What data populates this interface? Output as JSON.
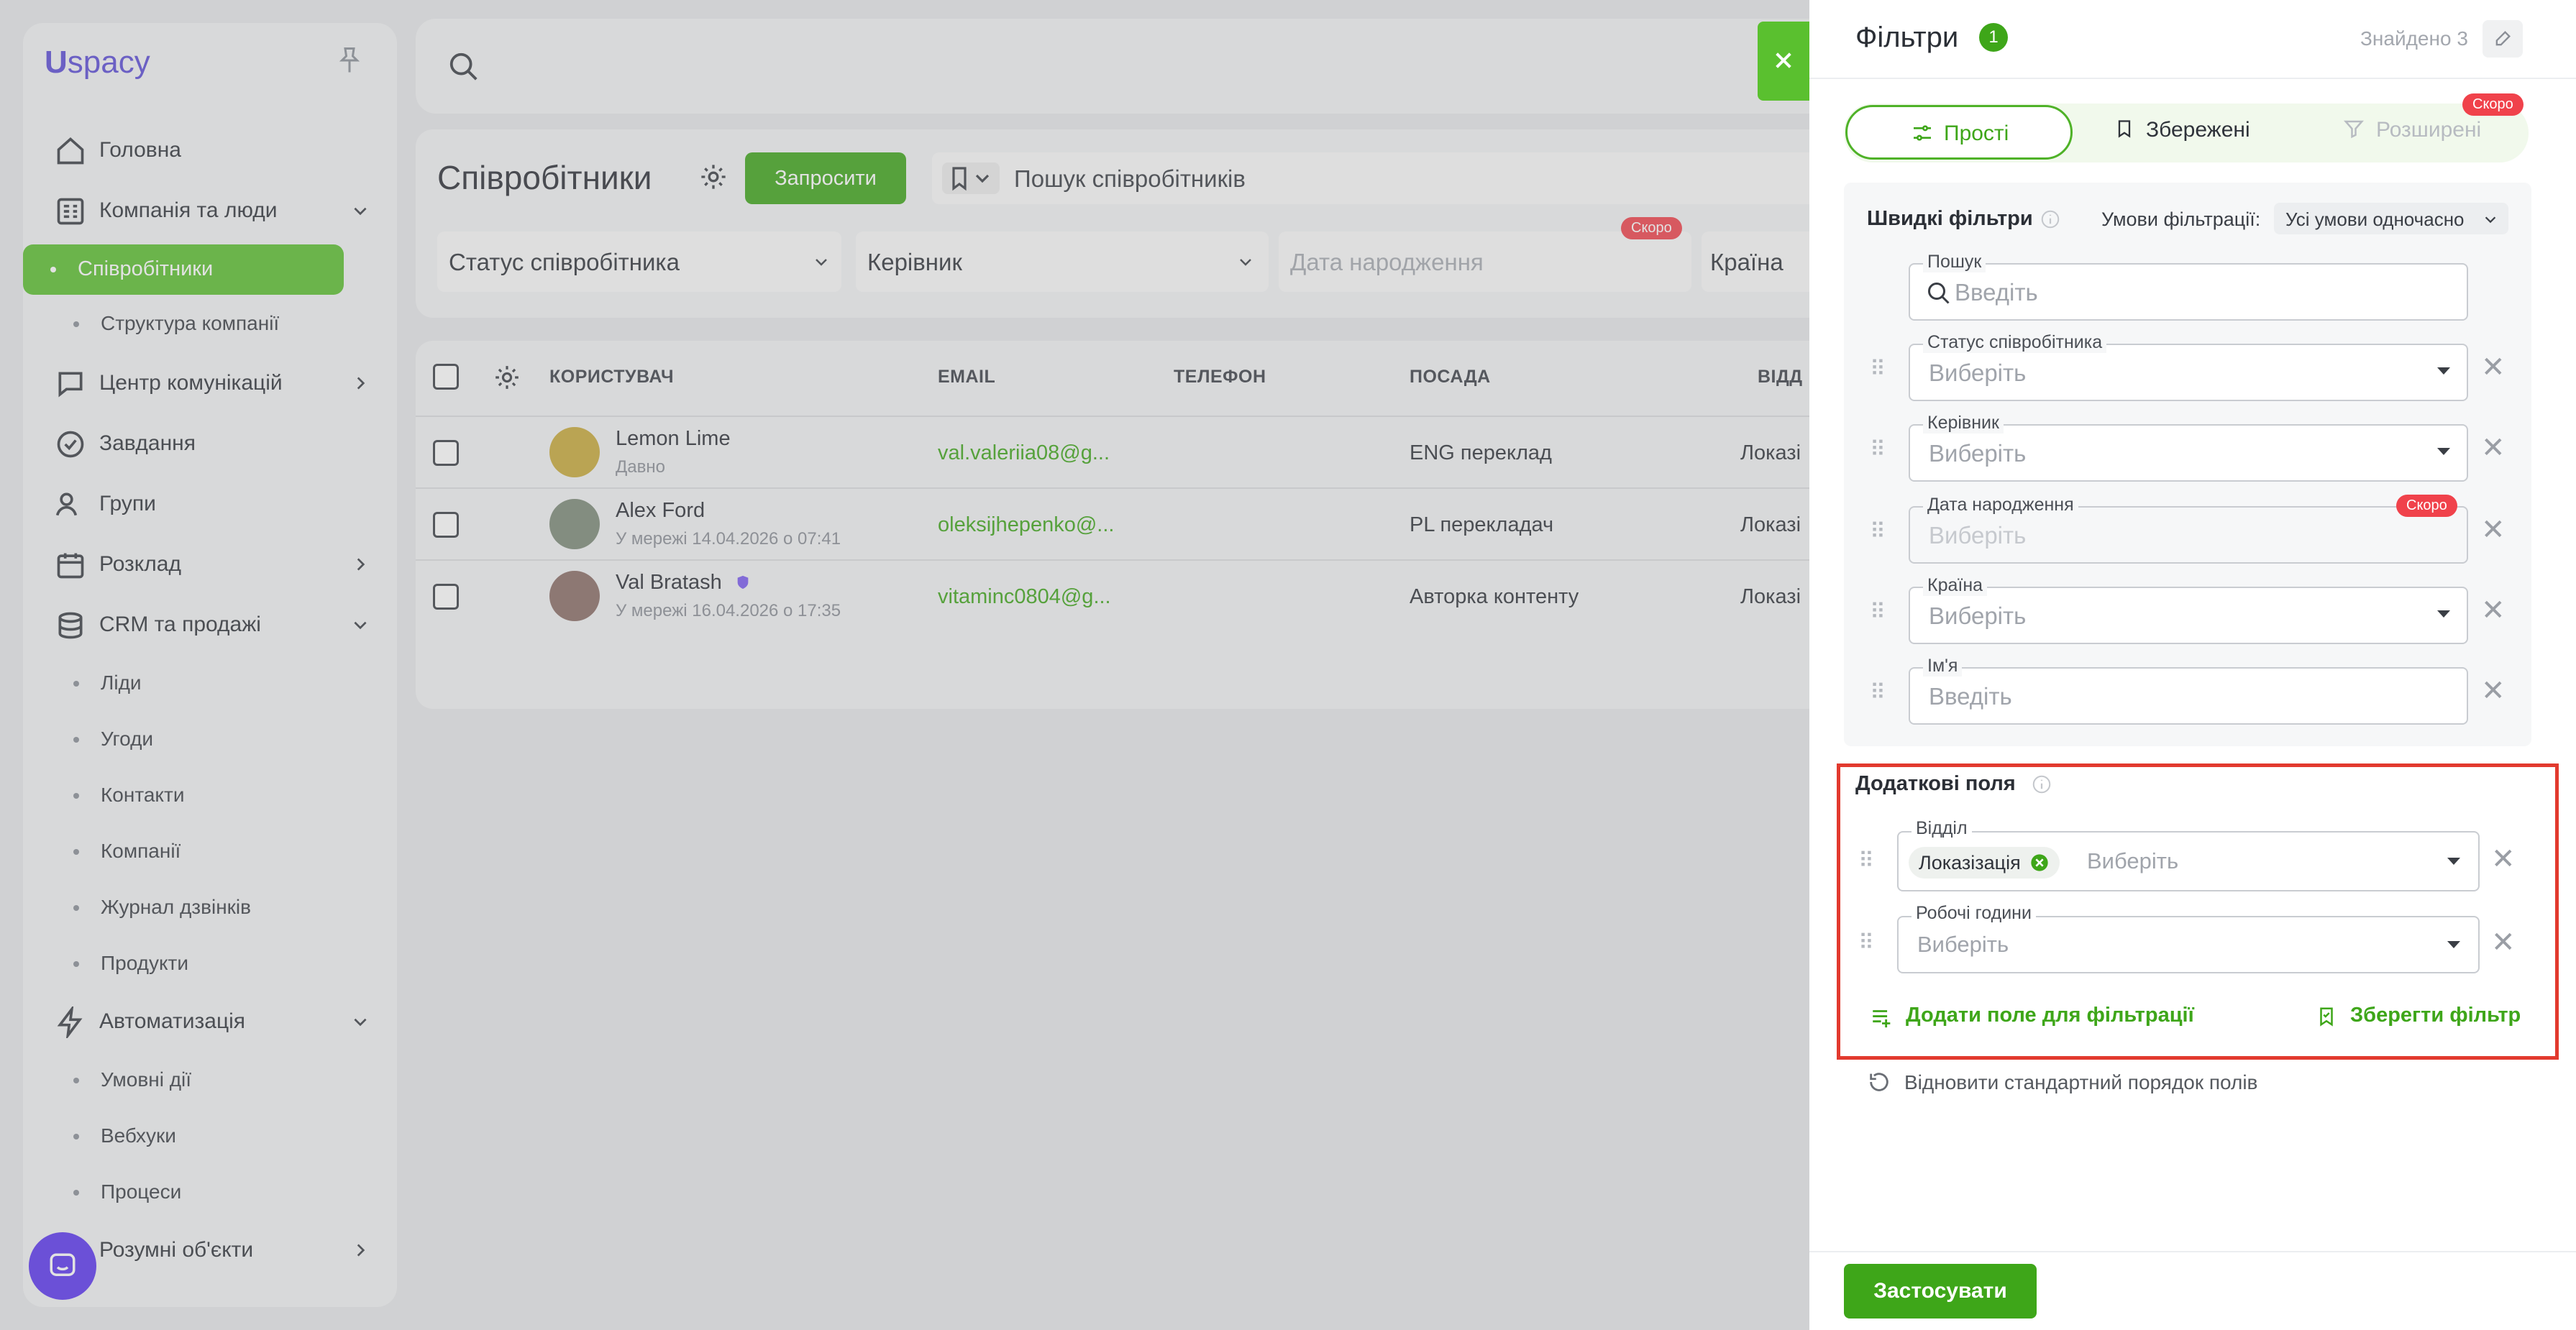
{
  "app": {
    "logo": "spacy",
    "logo_mark": "U"
  },
  "sidebar": {
    "items": [
      {
        "label": "Головна",
        "icon": "home-icon",
        "chevron": ""
      },
      {
        "label": "Компанія та люди",
        "icon": "company-icon",
        "chevron": "down"
      },
      {
        "label": "Центр комунікацій",
        "icon": "chat-icon",
        "chevron": "right"
      },
      {
        "label": "Завдання",
        "icon": "task-icon",
        "chevron": ""
      },
      {
        "label": "Групи",
        "icon": "groups-icon",
        "chevron": ""
      },
      {
        "label": "Розклад",
        "icon": "calendar-icon",
        "chevron": "right"
      },
      {
        "label": "CRM та продажі",
        "icon": "crm-icon",
        "chevron": "down"
      },
      {
        "label": "Автоматизація",
        "icon": "lightning-icon",
        "chevron": "down"
      },
      {
        "label": "Розумні об'єкти",
        "icon": "objects-icon",
        "chevron": "right"
      }
    ],
    "company_sub": [
      "Співробітники",
      "Структура компанії"
    ],
    "crm_sub": [
      "Ліди",
      "Угоди",
      "Контакти",
      "Компанії",
      "Журнал дзвінків",
      "Продукти"
    ],
    "auto_sub": [
      "Умовні дії",
      "Вебхуки",
      "Процеси"
    ]
  },
  "main": {
    "title": "Співробітники",
    "invite": "Запросити",
    "search_placeholder": "Пошук співробітників",
    "filters": [
      "Статус співробітника",
      "Керівник",
      "Дата народження",
      "Країна"
    ],
    "soon": "Скоро",
    "columns": [
      "КОРИСТУВАЧ",
      "EMAIL",
      "ТЕЛЕФОН",
      "ПОСАДА",
      "ВІДД"
    ],
    "rows": [
      {
        "name": "Lemon Lime",
        "sub": "Давно",
        "email": "val.valeriia08@g...",
        "position": "ENG переклад",
        "dept": "Локазі"
      },
      {
        "name": "Alex Ford",
        "sub": "У мережі 14.04.2026 о 07:41",
        "email": "oleksijhepenko@...",
        "position": "PL перекладач",
        "dept": "Локазі"
      },
      {
        "name": "Val Bratash",
        "sub": "У мережі 16.04.2026 о 17:35",
        "email": "vitaminc0804@g...",
        "position": "Авторка контенту",
        "dept": "Локазі"
      }
    ]
  },
  "panel": {
    "title": "Фільтри",
    "badge": "1",
    "found": "Знайдено 3",
    "tabs": [
      "Прості",
      "Збережені",
      "Розширені"
    ],
    "soon": "Скоро",
    "quick_title": "Швидкі фільтри",
    "conditions_label": "Умови фільтрації:",
    "conditions_value": "Усі умови одночасно",
    "fields": [
      {
        "label": "Пошук",
        "placeholder": "Введіть"
      },
      {
        "label": "Статус співробітника",
        "placeholder": "Виберіть"
      },
      {
        "label": "Керівник",
        "placeholder": "Виберіть"
      },
      {
        "label": "Дата народження",
        "placeholder": "Виберіть"
      },
      {
        "label": "Країна",
        "placeholder": "Виберіть"
      },
      {
        "label": "Ім'я",
        "placeholder": "Введіть"
      }
    ],
    "extra_title": "Додаткові поля",
    "extra_fields": [
      {
        "label": "Відділ",
        "chip": "Локазізація",
        "placeholder": "Виберіть"
      },
      {
        "label": "Робочі години",
        "placeholder": "Виберіть"
      }
    ],
    "add_field": "Додати поле для фільтрації",
    "save_filter": "Зберегти фільтр",
    "restore": "Відновити стандартний порядок полів",
    "apply": "Застосувати"
  },
  "colors": {
    "accent": "#3ea619",
    "highlight": "#e23a2e",
    "soon": "#f0424b"
  }
}
